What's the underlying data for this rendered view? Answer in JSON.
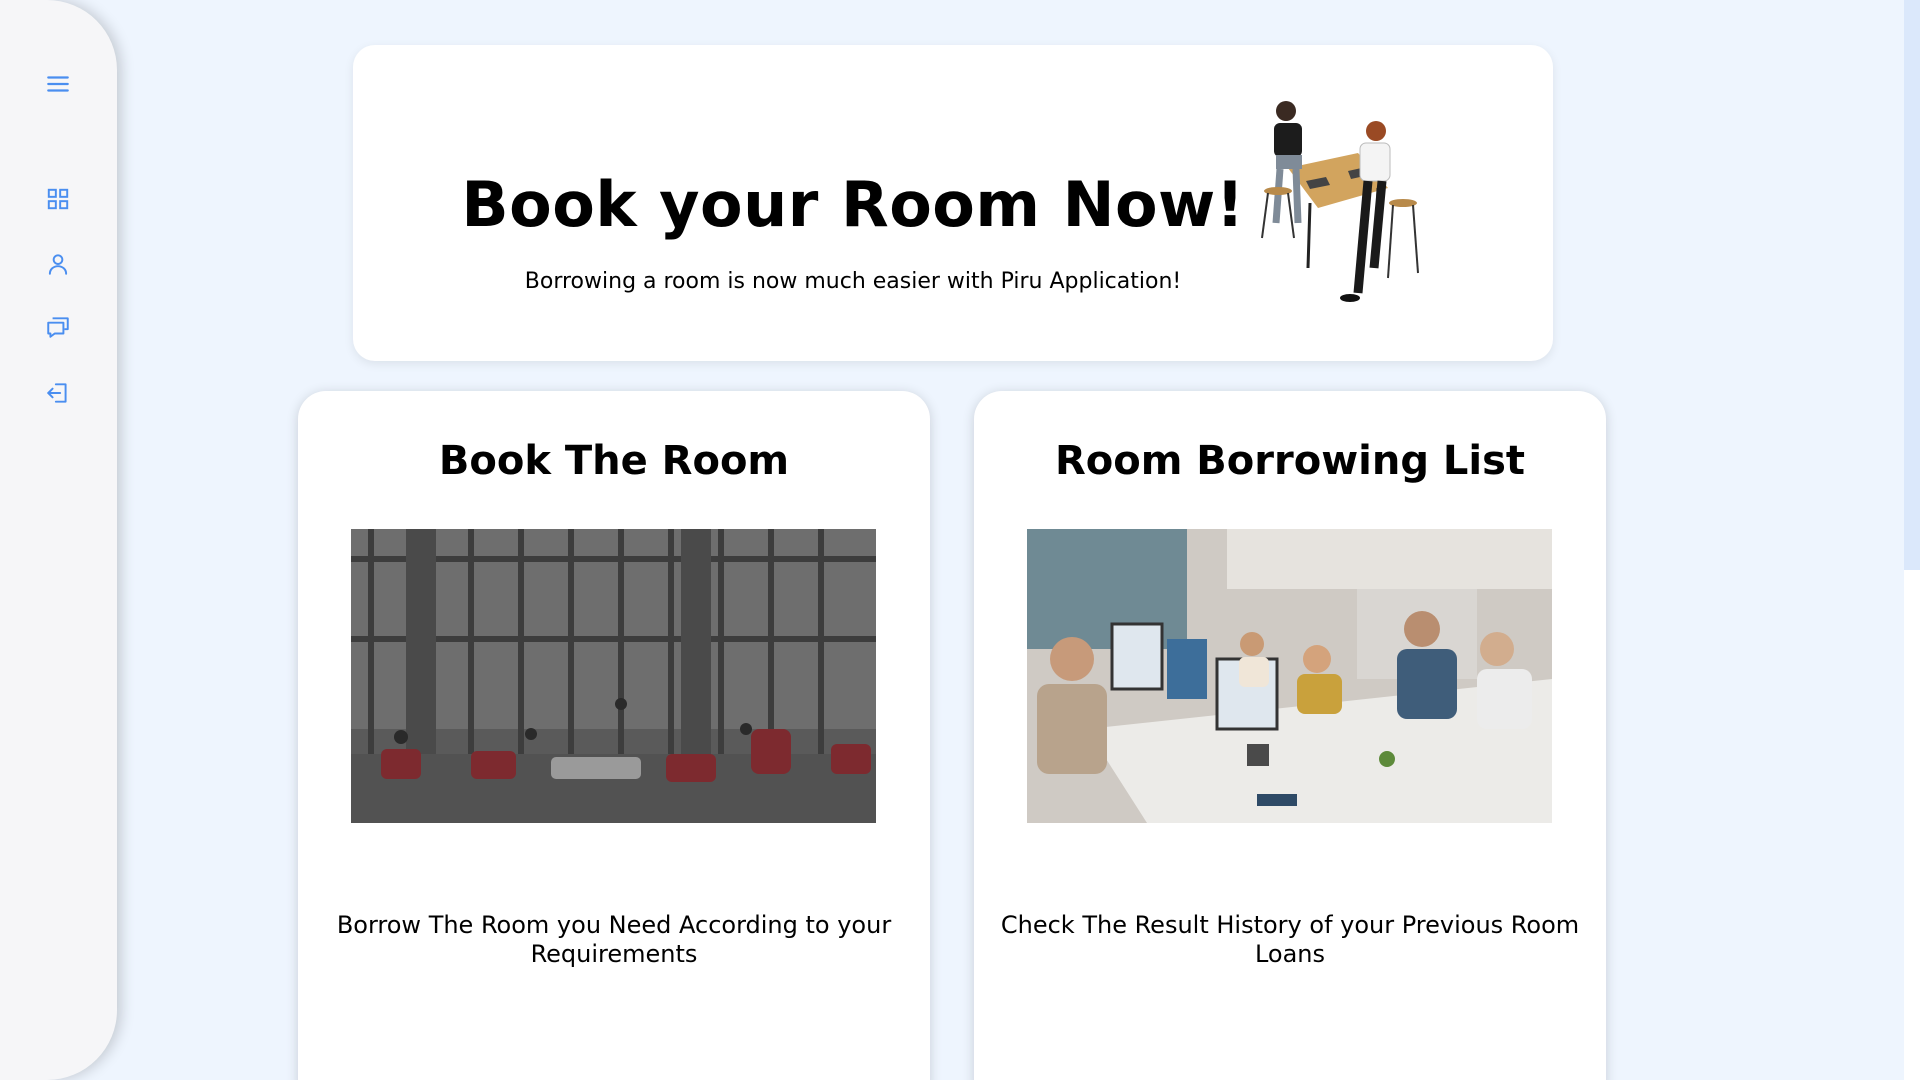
{
  "sidebar": {
    "icons": [
      {
        "name": "menu-icon",
        "color": "#4a8ef0"
      },
      {
        "name": "dashboard-grid-icon",
        "color": "#4a8ef0"
      },
      {
        "name": "user-icon",
        "color": "#4a8ef0"
      },
      {
        "name": "chat-icon",
        "color": "#4a8ef0"
      },
      {
        "name": "logout-icon",
        "color": "#4a8ef0"
      }
    ]
  },
  "hero": {
    "title": "Book your Room Now!",
    "subtitle": "Borrowing a room is now much easier with Piru Application!"
  },
  "cards": [
    {
      "title": "Book The Room",
      "description": "Borrow The Room you Need According to your Requirements"
    },
    {
      "title": "Room Borrowing List",
      "description": "Check The Result History of your Previous Room Loans"
    }
  ],
  "colors": {
    "background": "#eef5fe",
    "accent": "#4a8ef0",
    "sidebar": "#f6f6f8"
  }
}
